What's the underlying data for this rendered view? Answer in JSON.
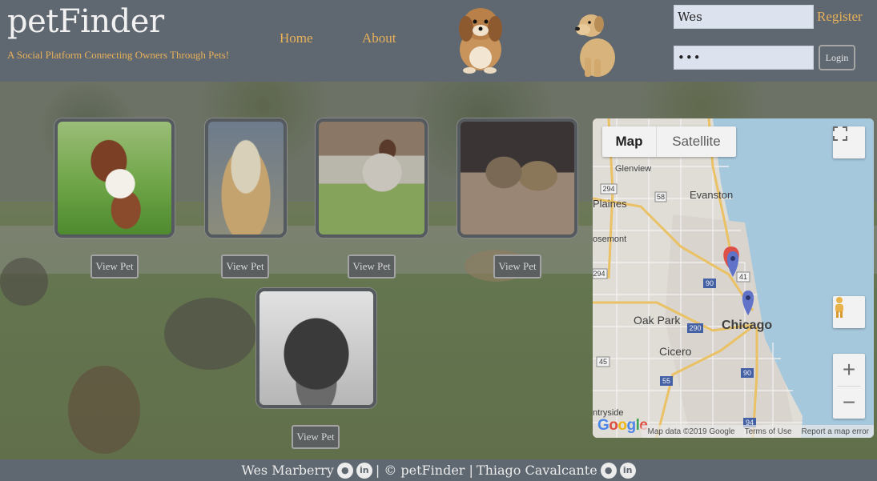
{
  "header": {
    "brand_title": "petFinder",
    "tagline": "A Social Platform Connecting Owners Through Pets!",
    "nav": {
      "home": "Home",
      "about": "About"
    },
    "login": {
      "username_value": "Wes",
      "password_value": "•••",
      "register_label": "Register",
      "login_label": "Login"
    },
    "colors": {
      "bar": "#5f6770",
      "accent": "#e8b15a"
    }
  },
  "pets": [
    {
      "view_label": "View Pet",
      "icon": "spaniel-puppy-photo"
    },
    {
      "view_label": "View Pet",
      "icon": "long-haired-dog-photo"
    },
    {
      "view_label": "View Pet",
      "icon": "pointer-dog-photo"
    },
    {
      "view_label": "View Pet",
      "icon": "two-cats-photo"
    },
    {
      "view_label": "View Pet",
      "icon": "black-dog-photo"
    }
  ],
  "map": {
    "type_map": "Map",
    "type_satellite": "Satellite",
    "zoom_in": "+",
    "zoom_out": "−",
    "places": {
      "glenview": "Glenview",
      "evanston": "Evanston",
      "plaines": "Plaines",
      "rosemont": "osemont",
      "oak_park": "Oak Park",
      "chicago": "Chicago",
      "cicero": "Cicero",
      "countryside": "ntryside"
    },
    "footer": {
      "data": "Map data ©2019 Google",
      "terms": "Terms of Use",
      "report": "Report a map error"
    },
    "logo": "Google"
  },
  "footer": {
    "author1": "Wes Marberry",
    "middle": "| © petFinder |",
    "author2": "Thiago Cavalcante"
  }
}
